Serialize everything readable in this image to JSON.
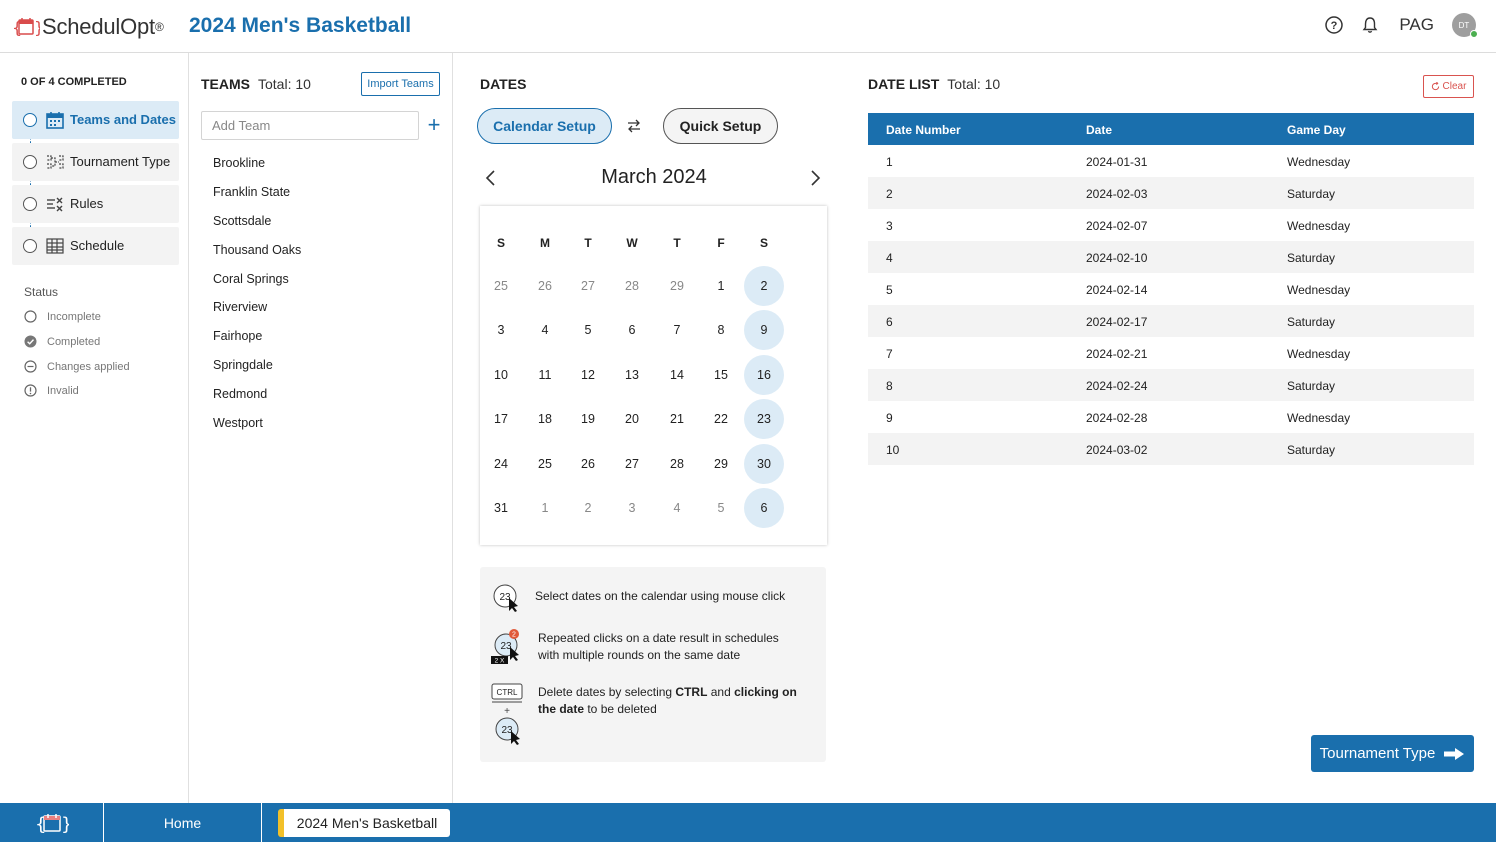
{
  "header": {
    "logo_text": "SchedulOpt",
    "logo_reg": "®",
    "title": "2024 Men's Basketball",
    "user": "PAG",
    "avatar_initials": "DT"
  },
  "sidebar": {
    "progress": "0 OF 4 COMPLETED",
    "steps": [
      {
        "label": "Teams and Dates",
        "icon": "calendar-icon",
        "active": true
      },
      {
        "label": "Tournament Type",
        "icon": "bracket-icon",
        "active": false
      },
      {
        "label": "Rules",
        "icon": "rules-icon",
        "active": false
      },
      {
        "label": "Schedule",
        "icon": "table-icon",
        "active": false
      }
    ],
    "status_title": "Status",
    "status_items": [
      "Incomplete",
      "Completed",
      "Changes applied",
      "Invalid"
    ]
  },
  "teams": {
    "title": "TEAMS",
    "total": "Total: 10",
    "import_label": "Import Teams",
    "add_placeholder": "Add Team",
    "list": [
      "Brookline",
      "Franklin State",
      "Scottsdale",
      "Thousand Oaks",
      "Coral Springs",
      "Riverview",
      "Fairhope",
      "Springdale",
      "Redmond",
      "Westport"
    ]
  },
  "dates": {
    "title": "DATES",
    "calendar_setup": "Calendar Setup",
    "quick_setup": "Quick Setup",
    "month": "March 2024",
    "weekdays": [
      "S",
      "M",
      "T",
      "W",
      "T",
      "F",
      "S"
    ],
    "weeks": [
      [
        {
          "d": "25",
          "m": true
        },
        {
          "d": "26",
          "m": true
        },
        {
          "d": "27",
          "m": true
        },
        {
          "d": "28",
          "m": true
        },
        {
          "d": "29",
          "m": true
        },
        {
          "d": "1"
        },
        {
          "d": "2",
          "s": true
        }
      ],
      [
        {
          "d": "3"
        },
        {
          "d": "4"
        },
        {
          "d": "5"
        },
        {
          "d": "6"
        },
        {
          "d": "7"
        },
        {
          "d": "8"
        },
        {
          "d": "9",
          "s": true
        }
      ],
      [
        {
          "d": "10"
        },
        {
          "d": "11"
        },
        {
          "d": "12"
        },
        {
          "d": "13"
        },
        {
          "d": "14"
        },
        {
          "d": "15"
        },
        {
          "d": "16",
          "s": true
        }
      ],
      [
        {
          "d": "17"
        },
        {
          "d": "18"
        },
        {
          "d": "19"
        },
        {
          "d": "20"
        },
        {
          "d": "21"
        },
        {
          "d": "22"
        },
        {
          "d": "23",
          "s": true
        }
      ],
      [
        {
          "d": "24"
        },
        {
          "d": "25"
        },
        {
          "d": "26"
        },
        {
          "d": "27"
        },
        {
          "d": "28"
        },
        {
          "d": "29"
        },
        {
          "d": "30",
          "s": true
        }
      ],
      [
        {
          "d": "31"
        },
        {
          "d": "1",
          "m": true
        },
        {
          "d": "2",
          "m": true
        },
        {
          "d": "3",
          "m": true
        },
        {
          "d": "4",
          "m": true
        },
        {
          "d": "5",
          "m": true
        },
        {
          "d": "6",
          "s": true
        }
      ]
    ],
    "help": {
      "icon_day": "23",
      "icon_badge": "2",
      "icon_times": "2 X",
      "icon_ctrl": "CTRL",
      "icon_plus": "+",
      "tip1": "Select dates on the calendar using mouse click",
      "tip2": "Repeated clicks on a date result in schedules with multiple rounds on the same date",
      "tip3_a": "Delete dates by selecting ",
      "tip3_b": "CTRL",
      "tip3_c": " and ",
      "tip3_d": "clicking on the date",
      "tip3_e": " to be deleted"
    }
  },
  "date_list": {
    "title": "DATE LIST",
    "total": "Total: 10",
    "clear_label": "Clear",
    "columns": [
      "Date Number",
      "Date",
      "Game Day"
    ],
    "rows": [
      [
        "1",
        "2024-01-31",
        "Wednesday"
      ],
      [
        "2",
        "2024-02-03",
        "Saturday"
      ],
      [
        "3",
        "2024-02-07",
        "Wednesday"
      ],
      [
        "4",
        "2024-02-10",
        "Saturday"
      ],
      [
        "5",
        "2024-02-14",
        "Wednesday"
      ],
      [
        "6",
        "2024-02-17",
        "Saturday"
      ],
      [
        "7",
        "2024-02-21",
        "Wednesday"
      ],
      [
        "8",
        "2024-02-24",
        "Saturday"
      ],
      [
        "9",
        "2024-02-28",
        "Wednesday"
      ],
      [
        "10",
        "2024-03-02",
        "Saturday"
      ]
    ]
  },
  "next_button": "Tournament Type",
  "footer": {
    "home": "Home",
    "tab": "2024 Men's Basketball"
  },
  "colors": {
    "primary": "#1a6fad",
    "selected_bg": "#dcebf6",
    "danger": "#d9534f",
    "tab_accent": "#f2c029"
  }
}
